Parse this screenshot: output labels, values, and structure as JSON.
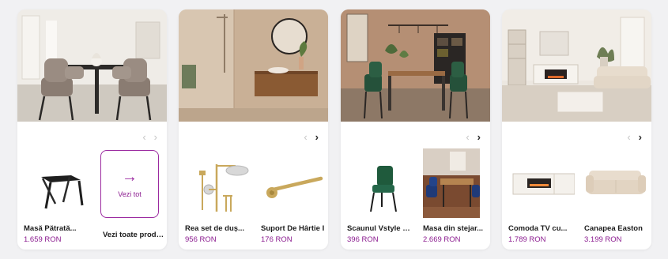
{
  "colors": {
    "price": "#8a1a8f",
    "accent": "#9b2aa0",
    "card_bg": "#ffffff",
    "page_bg": "#f1f1f3"
  },
  "nav_icons": {
    "prev": "chevron-left-icon",
    "next": "chevron-right-icon"
  },
  "prev_glyph": "‹",
  "next_glyph": "›",
  "cards": [
    {
      "hero": "dining-room-photo",
      "products": [
        {
          "name": "Masă Pătrată...",
          "price": "1.659 RON"
        }
      ],
      "view_all": {
        "label": "Vezi tot",
        "caption": "Vezi toate produs",
        "arrow": "→"
      }
    },
    {
      "hero": "bathroom-photo",
      "products": [
        {
          "name": "Rea set de duș...",
          "price": "956 RON"
        },
        {
          "name": "Suport De Hârtie I",
          "price": "176 RON"
        }
      ]
    },
    {
      "hero": "dining-kitchen-photo",
      "products": [
        {
          "name": "Scaunul Vstyle Opal...",
          "price": "396 RON"
        },
        {
          "name": "Masa din stejar...",
          "price": "2.669 RON"
        }
      ]
    },
    {
      "hero": "living-room-photo",
      "products": [
        {
          "name": "Comoda TV cu...",
          "price": "1.789 RON"
        },
        {
          "name": "Canapea Easton",
          "price": "3.199 RON"
        }
      ]
    }
  ]
}
